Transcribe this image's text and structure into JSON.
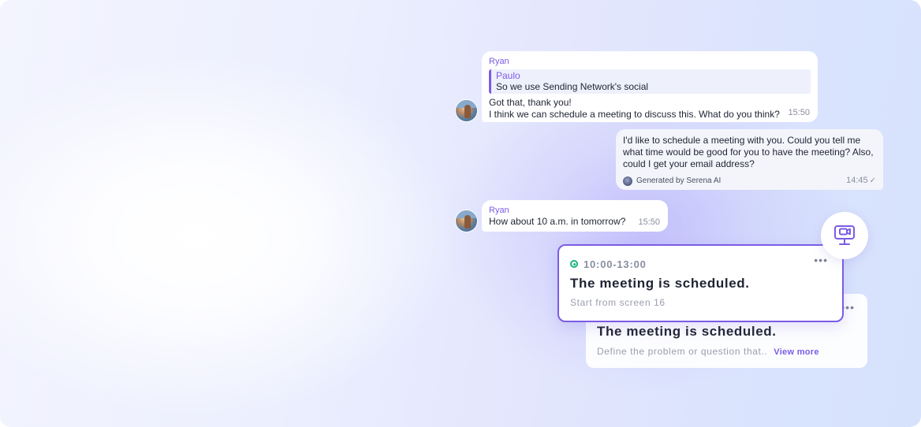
{
  "messages": [
    {
      "sender": "Ryan",
      "quote": {
        "name": "Paulo",
        "text": "So we use Sending Network's social"
      },
      "lines": [
        "Got that, thank you!",
        "I think we can schedule a meeting to discuss this. What do you think?"
      ],
      "time": "15:50"
    },
    {
      "lines": [
        "I'd like to schedule a meeting with you. Could you tell me",
        "what time would be good for you to have the meeting? Also,",
        "could I get your email address?"
      ],
      "generated_by": "Generated by Serena AI",
      "time": "14:45"
    },
    {
      "sender": "Ryan",
      "lines": [
        "How about 10 a.m. in tomorrow?"
      ],
      "time": "15:50"
    }
  ],
  "meeting_card": {
    "time_range": "10:00-13:00",
    "title": "The meeting is scheduled.",
    "subtitle": "Start from screen 16",
    "status_color": "#18b47e"
  },
  "back_card": {
    "title": "The meeting is scheduled.",
    "description": "Define the problem or question that..",
    "view_more": "View more"
  },
  "icons": {
    "meeting_button": "monitor-camera-icon",
    "more": "more-dots-icon",
    "read_status": "check-icon"
  },
  "colors": {
    "accent": "#7b5ce6",
    "status_green": "#18b47e"
  }
}
